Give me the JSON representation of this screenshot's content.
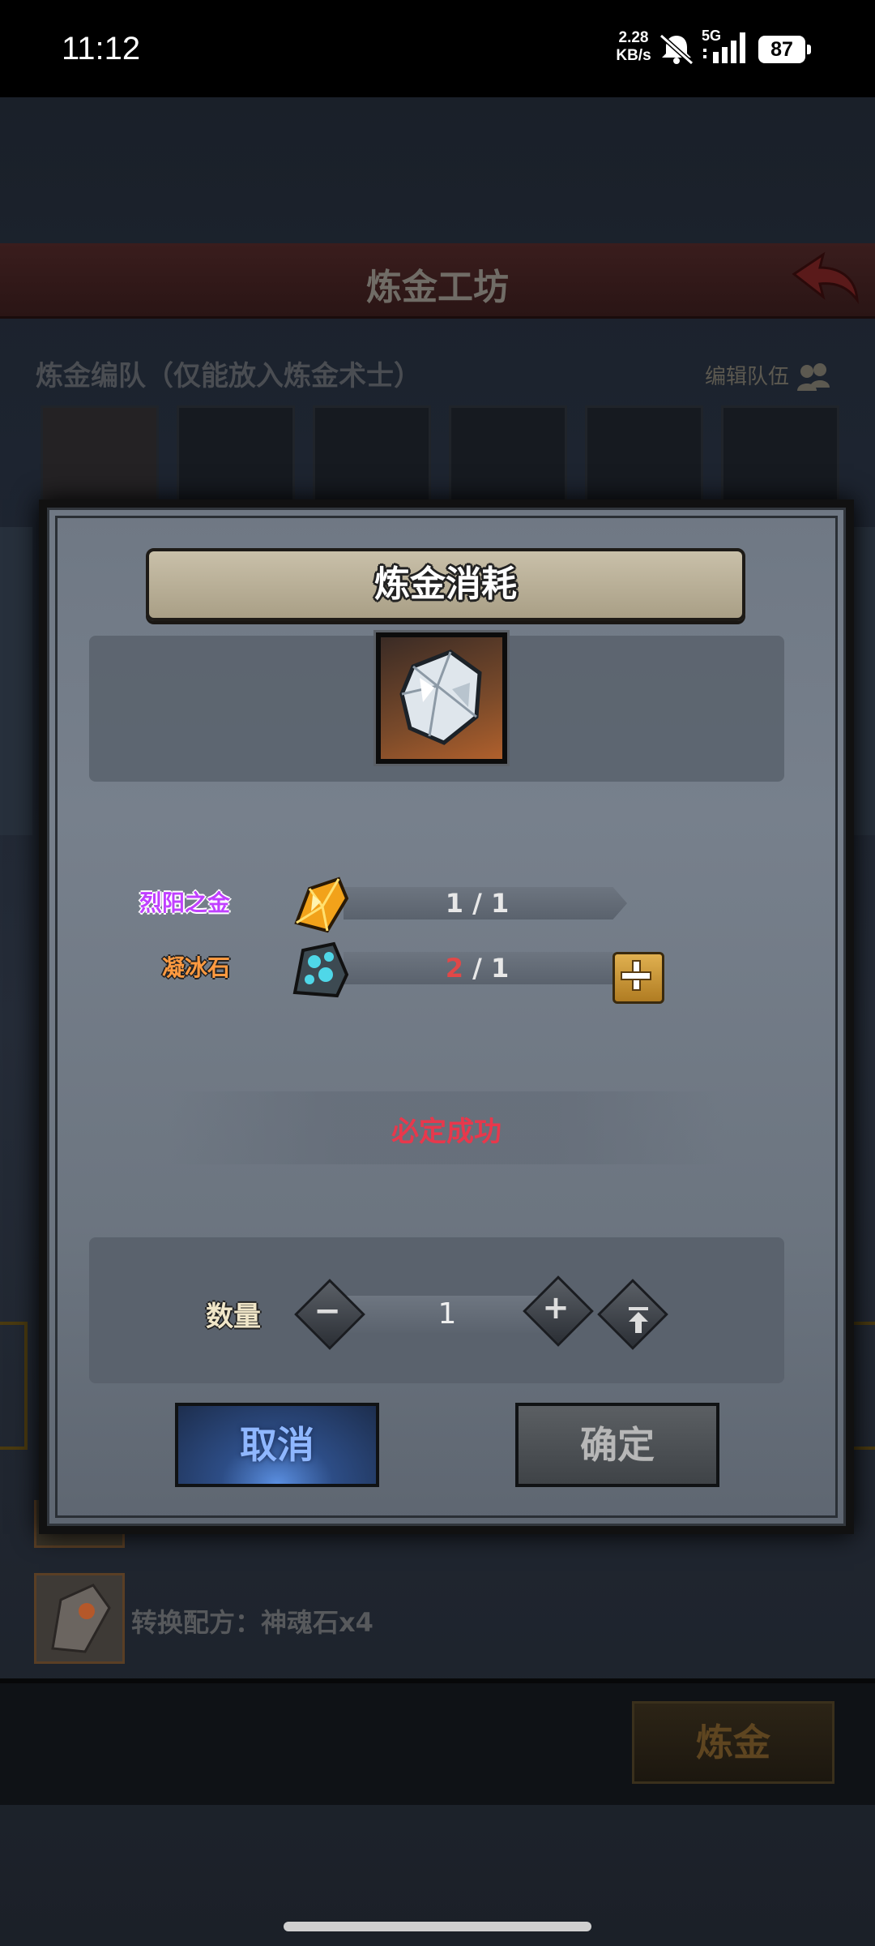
{
  "status_bar": {
    "time": "11:12",
    "net_speed_value": "2.28",
    "net_speed_unit": "KB/s",
    "network": "5G",
    "battery": "87",
    "icons": [
      "mute-icon",
      "signal-icon",
      "battery-icon"
    ]
  },
  "background_screen": {
    "title": "炼金工坊",
    "team_label": "炼金编队（仅能放入炼金术士）",
    "edit_team": "编辑队伍",
    "recipe_text": "转换配方：神魂石x4",
    "alchemy_button": "炼金"
  },
  "dialog": {
    "title": "炼金消耗",
    "product_icon": "ice-crystal-icon",
    "materials": [
      {
        "name": "烈阳之金",
        "icon": "sun-gold-icon",
        "have": "1",
        "need": "1",
        "color": "#c040ff"
      },
      {
        "name": "凝冰石",
        "icon": "frost-stone-icon",
        "have": "2",
        "need": "1",
        "color": "#ff9a40"
      }
    ],
    "success_text": "必定成功",
    "quantity_label": "数量",
    "quantity_value": "1",
    "cancel_label": "取消",
    "confirm_label": "确定"
  },
  "colors": {
    "success": "#e8384c",
    "cancel_text": "#8fb7ff",
    "count_short": "#e04848"
  }
}
